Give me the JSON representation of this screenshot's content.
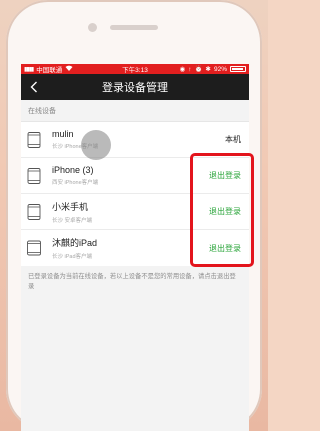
{
  "status_bar": {
    "carrier": "中国联通",
    "time": "下午3:13",
    "battery": "92%"
  },
  "navbar": {
    "title": "登录设备管理"
  },
  "section_label": "在线设备",
  "devices": [
    {
      "name": "mulin",
      "location": "长沙",
      "client": "iPhone客户端",
      "action": "本机"
    },
    {
      "name": "iPhone (3)",
      "location": "西安",
      "client": "iPhone客户端",
      "action": "退出登录"
    },
    {
      "name": "小米手机",
      "location": "长沙",
      "client": "安卓客户端",
      "action": "退出登录"
    },
    {
      "name": "沐麒的iPad",
      "location": "长沙",
      "client": "iPad客户端",
      "action": "退出登录"
    }
  ],
  "footnote": "已登录设备为当前在线设备，若以上设备不是您的常用设备，请点击退出登录",
  "colors": {
    "status_bar": "#e21f1f",
    "navbar": "#1d1d1d",
    "logout_action": "#2aa43a",
    "annotation_box": "#e3141c"
  }
}
